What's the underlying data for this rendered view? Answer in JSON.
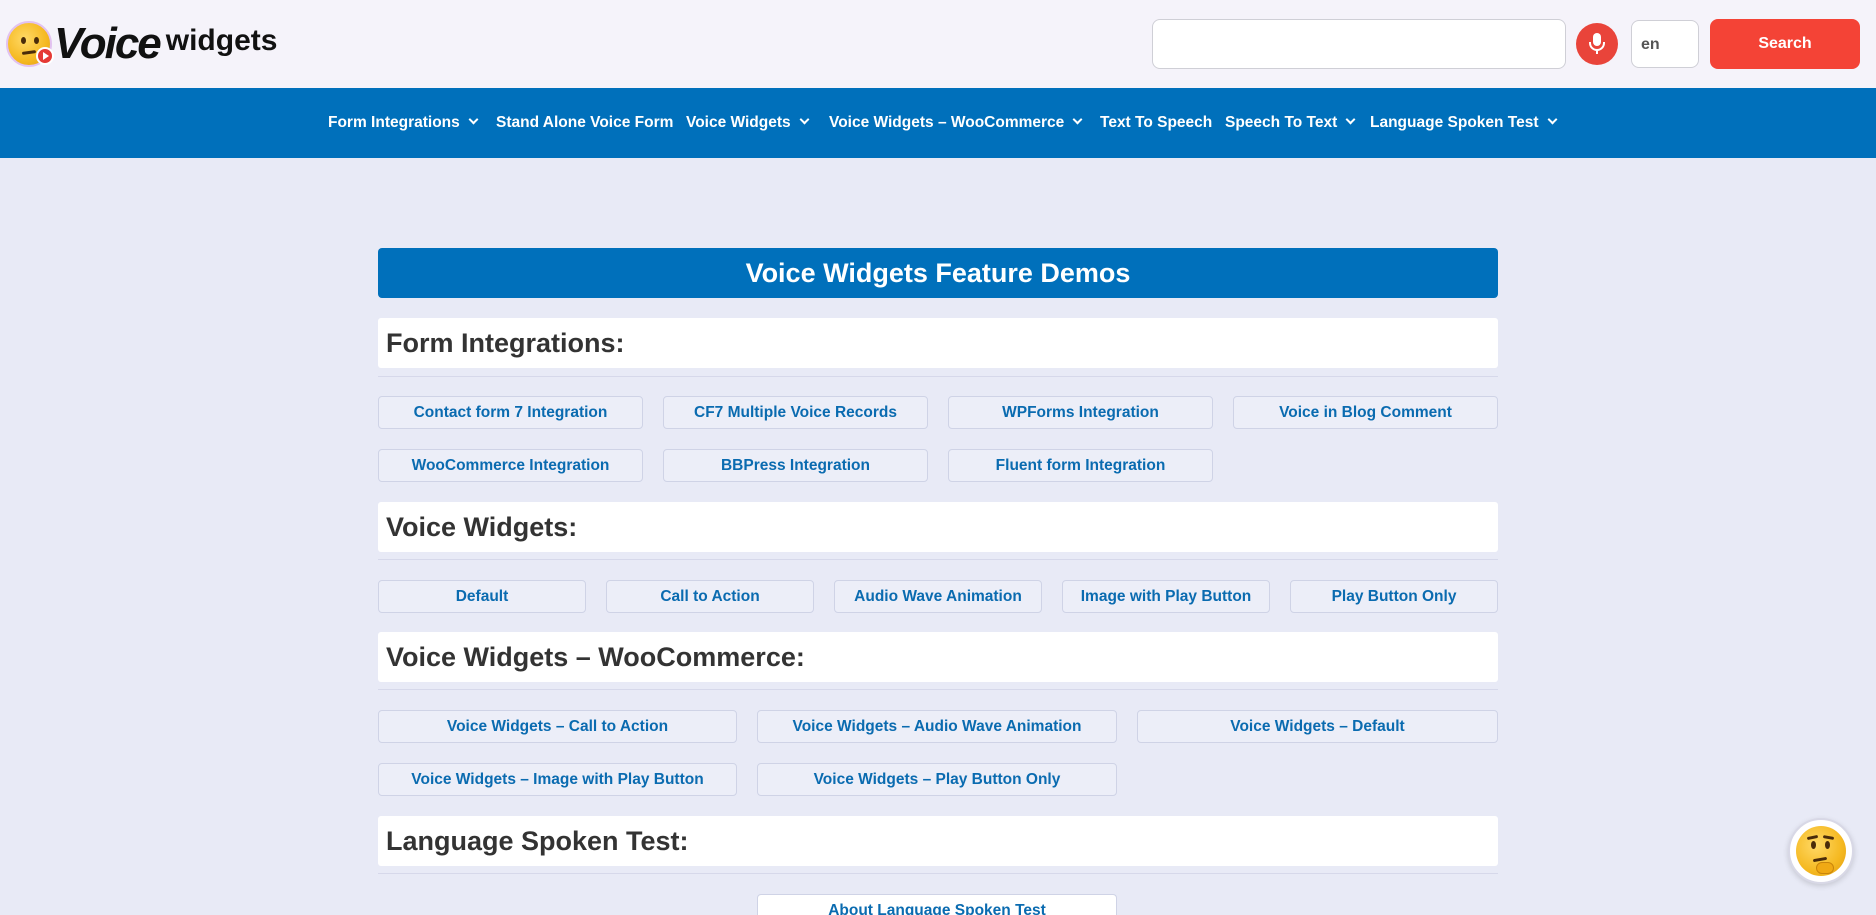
{
  "header": {
    "logo": {
      "word1": "Voice",
      "word2": "widgets"
    },
    "search": {
      "value": "",
      "placeholder": ""
    },
    "language": "en",
    "search_button": "Search",
    "colors": {
      "header_bg": "#f5f3fa",
      "search_button": "#f44336",
      "mic_button": "#e9443a"
    }
  },
  "nav": {
    "items": [
      {
        "label": "Form Integrations",
        "dropdown": true
      },
      {
        "label": "Stand Alone Voice Form",
        "dropdown": false
      },
      {
        "label": "Voice Widgets",
        "dropdown": true
      },
      {
        "label": "Voice Widgets – WooCommerce",
        "dropdown": true
      },
      {
        "label": "Text To Speech",
        "dropdown": false
      },
      {
        "label": "Speech To Text",
        "dropdown": true
      },
      {
        "label": "Language Spoken Test",
        "dropdown": true
      }
    ],
    "color": "#0070bb"
  },
  "main": {
    "banner": "Voice Widgets Feature Demos",
    "sections": [
      {
        "title": "Form Integrations:",
        "links": [
          "Contact form 7 Integration",
          "CF7 Multiple Voice Records",
          "WPForms Integration",
          "Voice in Blog Comment",
          "WooCommerce Integration",
          "BBPress Integration",
          "Fluent form Integration"
        ]
      },
      {
        "title": "Voice Widgets:",
        "links": [
          "Default",
          "Call to Action",
          "Audio Wave Animation",
          "Image with Play Button",
          "Play Button Only"
        ]
      },
      {
        "title": "Voice Widgets – WooCommerce:",
        "links": [
          "Voice Widgets – Call to Action",
          "Voice Widgets – Audio Wave Animation",
          "Voice Widgets – Default",
          "Voice Widgets – Image with Play Button",
          "Voice Widgets – Play Button Only"
        ]
      },
      {
        "title": "Language Spoken Test:",
        "links": [
          "About Language Spoken Test"
        ]
      }
    ],
    "link_color": "#0a6bb0"
  },
  "chat_bubble": {
    "icon": "thinking-face-icon"
  }
}
